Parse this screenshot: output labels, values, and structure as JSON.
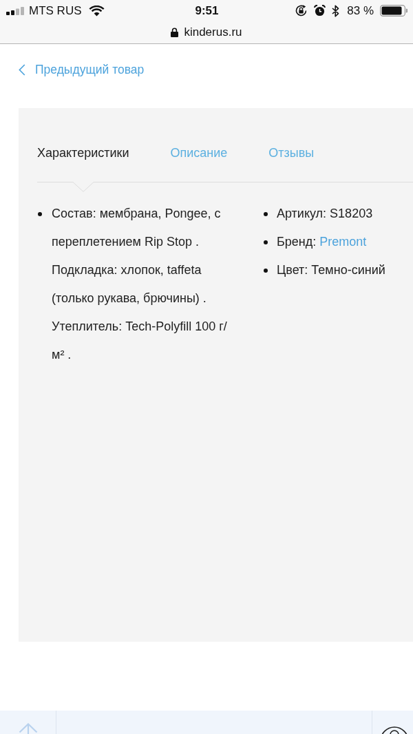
{
  "status_bar": {
    "carrier": "MTS RUS",
    "time": "9:51",
    "battery": "83 %"
  },
  "address_bar": {
    "url": "kinderus.ru"
  },
  "back_link": {
    "label": "Предыдущий товар"
  },
  "tabs": [
    {
      "label": "Характеристики",
      "selected": true
    },
    {
      "label": "Описание",
      "selected": false
    },
    {
      "label": "Отзывы",
      "selected": false
    }
  ],
  "specs": {
    "column_1": [
      {
        "kind": "paragraph",
        "text": "Состав: мембрана, Pongee, с переплетением Rip Stop . Подкладка: хлопок, taffeta (только рукава, брючины) . Утеплитель: Tech-Polyfill 100 г/м² ."
      }
    ],
    "column_2": [
      {
        "kind": "paragraph",
        "text": "Артикул: S18203"
      },
      {
        "kind": "link",
        "label": "Бренд:",
        "link": "Premont"
      },
      {
        "kind": "paragraph",
        "text": "Цвет: Темно-синий"
      }
    ]
  }
}
